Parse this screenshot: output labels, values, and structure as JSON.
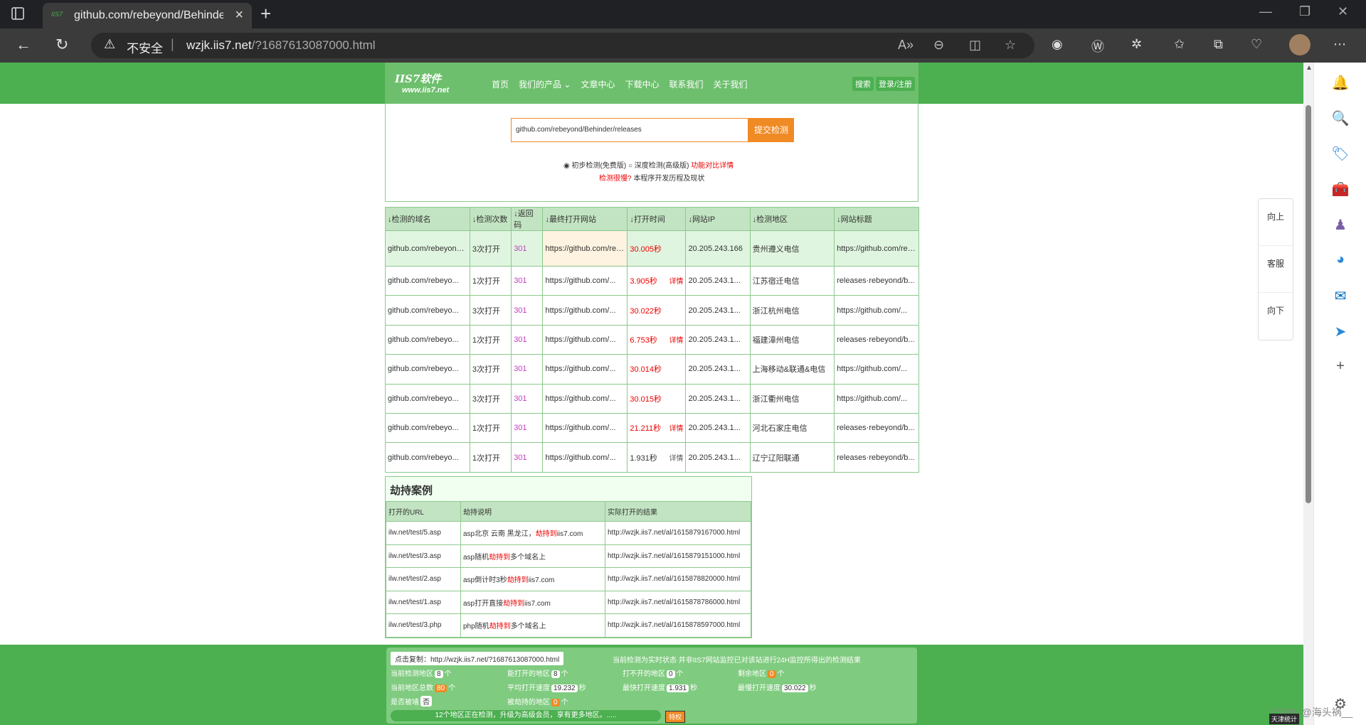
{
  "browser": {
    "tab_title": "github.com/rebeyond/Behinder/",
    "tab_favicon": "IIS7",
    "insecure_label": "不安全",
    "url_host": "wzjk.iis7.net",
    "url_path": "/?1687613087000.html"
  },
  "site": {
    "logo_line1": "IIS7软件",
    "logo_line2": "www.iis7.net",
    "nav": [
      "首页",
      "我们的产品",
      "文章中心",
      "下载中心",
      "联系我们",
      "关于我们"
    ],
    "search_btn": "搜索",
    "login_btn": "登录/注册"
  },
  "search": {
    "value": "github.com/rebeyond/Behinder/releases",
    "submit": "提交检测",
    "opt_free": "初步检测(免费版)",
    "opt_deep": "深度检测(高级版)",
    "compare": "功能对比详情",
    "hijacked": "检测很慢?",
    "history": "本程序开发历程及现状"
  },
  "results": {
    "headers": [
      "↓检测的域名",
      "↓检测次数",
      "↓返回码",
      "↓最终打开网站",
      "↓打开时间",
      "↓网站IP",
      "↓检测地区",
      "↓网站标题"
    ],
    "first": {
      "domain": "github.com/rebeyond/Behinder/releases",
      "count": "3次打开",
      "code": "301",
      "final": "https://github.com/rebeyond/Behinder/releases",
      "time": "30.005秒",
      "ip": "20.205.243.166",
      "region": "贵州遵义电信",
      "title": "https://github.com/rebeyond/Behinder/releases"
    },
    "rows": [
      {
        "domain": "github.com/rebeyo...",
        "count": "1次打开",
        "code": "301",
        "final": "https://github.com/...",
        "time": "3.905秒",
        "detail": "详情",
        "ip": "20.205.243.1...",
        "region": "江苏宿迁电信",
        "title": "releases·rebeyond/b..."
      },
      {
        "domain": "github.com/rebeyo...",
        "count": "3次打开",
        "code": "301",
        "final": "https://github.com/...",
        "time": "30.022秒",
        "detail": "",
        "ip": "20.205.243.1...",
        "region": "浙江杭州电信",
        "title": "https://github.com/..."
      },
      {
        "domain": "github.com/rebeyo...",
        "count": "1次打开",
        "code": "301",
        "final": "https://github.com/...",
        "time": "6.753秒",
        "detail": "详情",
        "ip": "20.205.243.1...",
        "region": "福建漳州电信",
        "title": "releases·rebeyond/b..."
      },
      {
        "domain": "github.com/rebeyo...",
        "count": "3次打开",
        "code": "301",
        "final": "https://github.com/...",
        "time": "30.014秒",
        "detail": "",
        "ip": "20.205.243.1...",
        "region": "上海移动&联通&电信",
        "title": "https://github.com/..."
      },
      {
        "domain": "github.com/rebeyo...",
        "count": "3次打开",
        "code": "301",
        "final": "https://github.com/...",
        "time": "30.015秒",
        "detail": "",
        "ip": "20.205.243.1...",
        "region": "浙江衢州电信",
        "title": "https://github.com/..."
      },
      {
        "domain": "github.com/rebeyo...",
        "count": "1次打开",
        "code": "301",
        "final": "https://github.com/...",
        "time": "21.211秒",
        "detail": "详情",
        "ip": "20.205.243.1...",
        "region": "河北石家庄电信",
        "title": "releases·rebeyond/b..."
      },
      {
        "domain": "github.com/rebeyo...",
        "count": "1次打开",
        "code": "301",
        "final": "https://github.com/...",
        "time": "1.931秒",
        "detail": "详情",
        "ip": "20.205.243.1...",
        "region": "辽宁辽阳联通",
        "title": "releases·rebeyond/b..."
      }
    ]
  },
  "hijack": {
    "title": "劫持案例",
    "headers": [
      "打开的URL",
      "劫持说明",
      "实际打开的结果"
    ],
    "rows": [
      {
        "url": "ilw.net/test/5.asp",
        "desc_a": "asp北京 云南 黑龙江，",
        "desc_r": "劫持到",
        "desc_b": "iis7.com",
        "result": "http://wzjk.iis7.net/al/1615879167000.html"
      },
      {
        "url": "ilw.net/test/3.asp",
        "desc_a": "asp随机",
        "desc_r": "劫持到",
        "desc_b": "多个域名上",
        "result": "http://wzjk.iis7.net/al/1615879151000.html"
      },
      {
        "url": "ilw.net/test/2.asp",
        "desc_a": "asp倒计时3秒",
        "desc_r": "劫持到",
        "desc_b": "iis7.com",
        "result": "http://wzjk.iis7.net/al/1615878820000.html"
      },
      {
        "url": "ilw.net/test/1.asp",
        "desc_a": "asp打开直接",
        "desc_r": "劫持到",
        "desc_b": "iis7.com",
        "result": "http://wzjk.iis7.net/al/1615878786000.html"
      },
      {
        "url": "ilw.net/test/3.php",
        "desc_a": "php随机",
        "desc_r": "劫持到",
        "desc_b": "多个域名上",
        "result": "http://wzjk.iis7.net/al/1615878597000.html"
      }
    ]
  },
  "footer": {
    "copy": "点击复制：http://wzjk.iis7.net/?1687613087000.html",
    "realtime": "当前检测为实时状态 并非IIS7网站监控已对该站进行24H监控所得出的检测结果",
    "s1_label": "当前检测地区",
    "s1_val": "8",
    "unit_ge": "个",
    "s2_label": "能打开的地区",
    "s2_val": "8",
    "s3_label": "打不开的地区",
    "s3_val": "0",
    "s4_label": "剩余地区",
    "s4_val": "0",
    "s5_label": "当前地区总数",
    "s5_val": "80",
    "s6_label": "平均打开速度",
    "s6_val": "19.232",
    "unit_s": "秒",
    "s7_label": "最快打开速度",
    "s7_val": "1.931",
    "s8_label": "最慢打开速度",
    "s8_val": "30.022",
    "s9_label": "是否被墙",
    "s9_val": "否",
    "s10_label": "被劫持的地区",
    "s10_val": "0",
    "progress": "12个地区正在检测，升级为高级会员，享有更多地区。.....",
    "special": "特权"
  },
  "float_nav": [
    "向上",
    "客服",
    "向下"
  ],
  "watermark": "CSDN @海头祸__",
  "tianjin": "天津统计"
}
